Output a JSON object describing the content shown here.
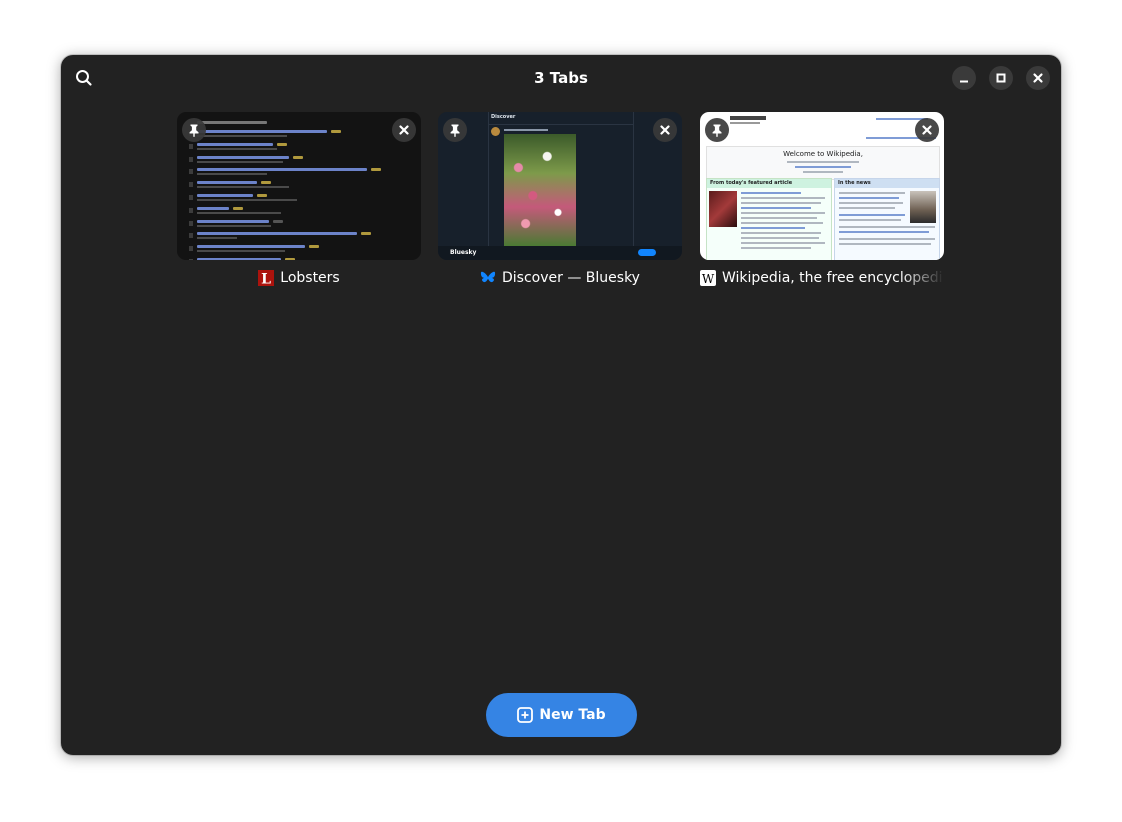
{
  "window": {
    "title": "3 Tabs",
    "controls": [
      "minimize",
      "maximize",
      "close"
    ]
  },
  "tabs": [
    {
      "title": "Lobsters",
      "favicon": "lobsters-logo",
      "pinned": false
    },
    {
      "title": "Discover — Bluesky",
      "favicon": "bluesky-butterfly-icon",
      "pinned": false,
      "preview": {
        "nav_label": "Discover",
        "brand": "Bluesky"
      }
    },
    {
      "title": "Wikipedia, the free encyclopedia",
      "favicon": "wikipedia-w-icon",
      "pinned": false,
      "preview": {
        "welcome": "Welcome to Wikipedia,",
        "featured_heading": "From today's featured article",
        "news_heading": "In the news"
      }
    }
  ],
  "actions": {
    "new_tab_label": "New Tab"
  },
  "colors": {
    "accent": "#3584e4",
    "window_bg": "#222222",
    "button_bg": "#3a3a3a"
  }
}
